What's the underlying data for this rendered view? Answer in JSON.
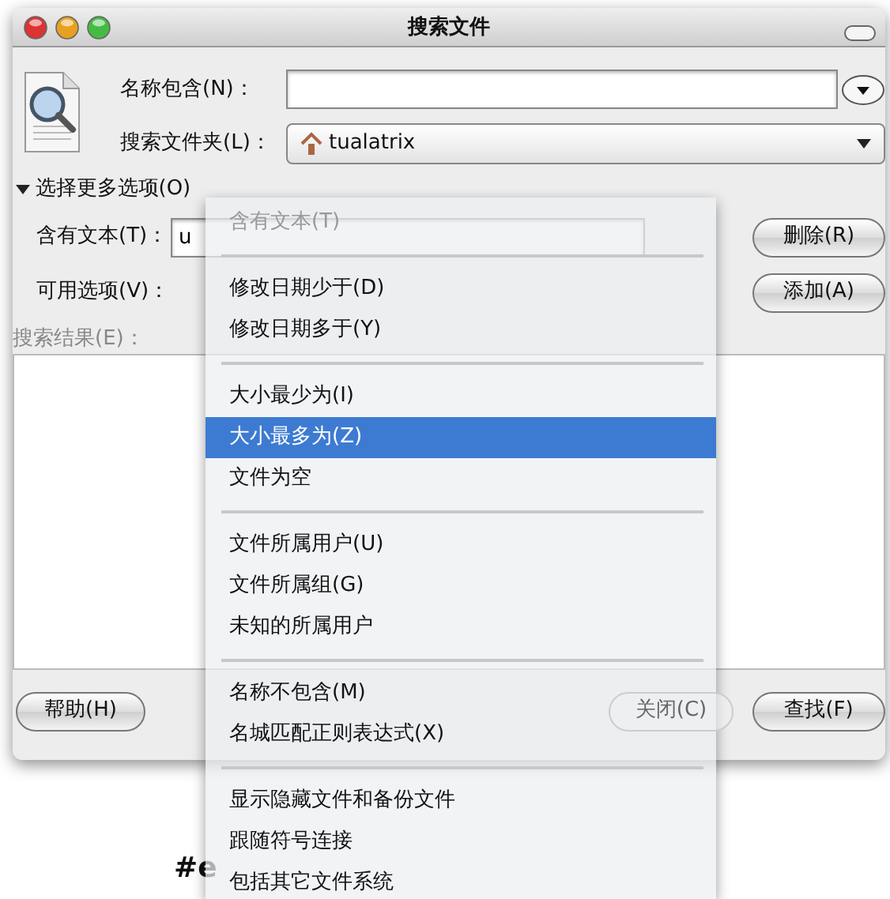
{
  "window": {
    "title": "搜索文件"
  },
  "name_field": {
    "label": "名称包含(N)："
  },
  "folder": {
    "label": "搜索文件夹(L)：",
    "value": "tualatrix"
  },
  "more_options": {
    "label": "选择更多选项(O)",
    "expanded": true
  },
  "contains_text": {
    "label": "含有文本(T)：",
    "value": "u"
  },
  "available_options": {
    "label": "可用选项(V)："
  },
  "results": {
    "label": "搜索结果(E)："
  },
  "buttons": {
    "remove": {
      "label": "删除(R)",
      "disabled": false
    },
    "add": {
      "label": "添加(A)",
      "disabled": false
    },
    "help": {
      "label": "帮助(H)",
      "disabled": false
    },
    "close": {
      "label": "关闭(C)",
      "disabled": true
    },
    "find": {
      "label": "查找(F)",
      "disabled": false
    }
  },
  "menu": {
    "items": [
      {
        "kind": "item",
        "label": "含有文本(T)",
        "disabled": true,
        "selected": false
      },
      {
        "kind": "separator"
      },
      {
        "kind": "item",
        "label": "修改日期少于(D)",
        "disabled": false,
        "selected": false
      },
      {
        "kind": "item",
        "label": "修改日期多于(Y)",
        "disabled": false,
        "selected": false
      },
      {
        "kind": "separator"
      },
      {
        "kind": "item",
        "label": "大小最少为(I)",
        "disabled": false,
        "selected": false
      },
      {
        "kind": "item",
        "label": "大小最多为(Z)",
        "disabled": false,
        "selected": true
      },
      {
        "kind": "item",
        "label": "文件为空",
        "disabled": false,
        "selected": false
      },
      {
        "kind": "separator"
      },
      {
        "kind": "item",
        "label": "文件所属用户(U)",
        "disabled": false,
        "selected": false
      },
      {
        "kind": "item",
        "label": "文件所属组(G)",
        "disabled": false,
        "selected": false
      },
      {
        "kind": "item",
        "label": "未知的所属用户",
        "disabled": false,
        "selected": false
      },
      {
        "kind": "separator"
      },
      {
        "kind": "item",
        "label": "名称不包含(M)",
        "disabled": false,
        "selected": false
      },
      {
        "kind": "item",
        "label": "名城匹配正则表达式(X)",
        "disabled": false,
        "selected": false
      },
      {
        "kind": "separator"
      },
      {
        "kind": "item",
        "label": "显示隐藏文件和备份文件",
        "disabled": false,
        "selected": false
      },
      {
        "kind": "item",
        "label": "跟随符号连接",
        "disabled": false,
        "selected": false
      },
      {
        "kind": "item",
        "label": "包括其它文件系统",
        "disabled": false,
        "selected": false
      }
    ]
  },
  "background_texts": [
    "#e"
  ]
}
